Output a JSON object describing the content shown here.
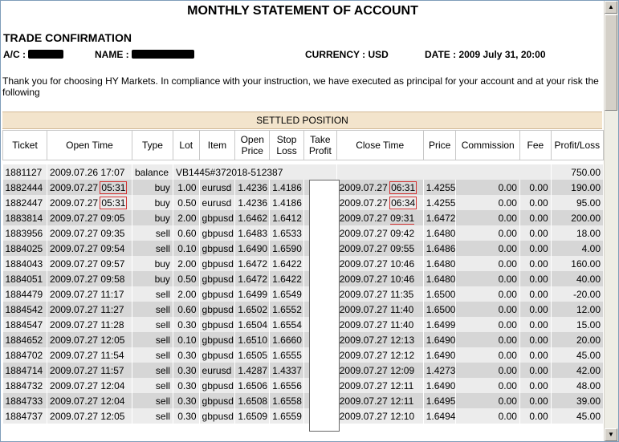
{
  "statement": {
    "title": "MONTHLY STATEMENT OF ACCOUNT",
    "section": "TRADE CONFIRMATION",
    "account_label": "A/C :",
    "name_label": "NAME :",
    "currency_label": "CURRENCY : USD",
    "date_label": "DATE : 2009 July 31, 20:00",
    "intro": "Thank you for choosing HY Markets. In compliance with your instruction, we have executed as principal for your account and at your risk the following",
    "settled_title": "SETTLED POSITION"
  },
  "table": {
    "headers": {
      "ticket": "Ticket",
      "open_time": "Open Time",
      "type": "Type",
      "lot": "Lot",
      "item": "Item",
      "open_price": "Open Price",
      "stop_loss": "Stop Loss",
      "take_profit": "Take Profit",
      "close_time": "Close Time",
      "price": "Price",
      "commission": "Commission",
      "fee": "Fee",
      "profit_loss": "Profit/Loss"
    },
    "balance_row": {
      "ticket": "1881127",
      "open_time": "2009.07.26 17:07",
      "type": "balance",
      "desc": "VB1445#372018-512387",
      "profit": "750.00"
    },
    "rows": [
      {
        "ticket": "1882444",
        "open_date": "2009.07.27",
        "open_hm": "05:31",
        "type": "buy",
        "lot": "1.00",
        "item": "eurusd",
        "open_price": "1.4236",
        "stop_loss": "1.4186",
        "close_date": "2009.07.27",
        "close_hm": "06:31",
        "price": "1.4255",
        "commission": "0.00",
        "fee": "0.00",
        "profit": "190.00"
      },
      {
        "ticket": "1882447",
        "open_date": "2009.07.27",
        "open_hm": "05:31",
        "type": "buy",
        "lot": "0.50",
        "item": "eurusd",
        "open_price": "1.4236",
        "stop_loss": "1.4186",
        "close_date": "2009.07.27",
        "close_hm": "06:34",
        "price": "1.4255",
        "commission": "0.00",
        "fee": "0.00",
        "profit": "95.00"
      },
      {
        "ticket": "1883814",
        "open_date": "2009.07.27",
        "open_hm": "09:05",
        "type": "buy",
        "lot": "2.00",
        "item": "gbpusd",
        "open_price": "1.6462",
        "stop_loss": "1.6412",
        "close_date": "2009.07.27",
        "close_hm": "09:31",
        "price": "1.6472",
        "commission": "0.00",
        "fee": "0.00",
        "profit": "200.00"
      },
      {
        "ticket": "1883956",
        "open_date": "2009.07.27",
        "open_hm": "09:35",
        "type": "sell",
        "lot": "0.60",
        "item": "gbpusd",
        "open_price": "1.6483",
        "stop_loss": "1.6533",
        "close_date": "2009.07.27",
        "close_hm": "09:42",
        "price": "1.6480",
        "commission": "0.00",
        "fee": "0.00",
        "profit": "18.00"
      },
      {
        "ticket": "1884025",
        "open_date": "2009.07.27",
        "open_hm": "09:54",
        "type": "sell",
        "lot": "0.10",
        "item": "gbpusd",
        "open_price": "1.6490",
        "stop_loss": "1.6590",
        "close_date": "2009.07.27",
        "close_hm": "09:55",
        "price": "1.6486",
        "commission": "0.00",
        "fee": "0.00",
        "profit": "4.00"
      },
      {
        "ticket": "1884043",
        "open_date": "2009.07.27",
        "open_hm": "09:57",
        "type": "buy",
        "lot": "2.00",
        "item": "gbpusd",
        "open_price": "1.6472",
        "stop_loss": "1.6422",
        "close_date": "2009.07.27",
        "close_hm": "10:46",
        "price": "1.6480",
        "commission": "0.00",
        "fee": "0.00",
        "profit": "160.00"
      },
      {
        "ticket": "1884051",
        "open_date": "2009.07.27",
        "open_hm": "09:58",
        "type": "buy",
        "lot": "0.50",
        "item": "gbpusd",
        "open_price": "1.6472",
        "stop_loss": "1.6422",
        "close_date": "2009.07.27",
        "close_hm": "10:46",
        "price": "1.6480",
        "commission": "0.00",
        "fee": "0.00",
        "profit": "40.00"
      },
      {
        "ticket": "1884479",
        "open_date": "2009.07.27",
        "open_hm": "11:17",
        "type": "sell",
        "lot": "2.00",
        "item": "gbpusd",
        "open_price": "1.6499",
        "stop_loss": "1.6549",
        "close_date": "2009.07.27",
        "close_hm": "11:35",
        "price": "1.6500",
        "commission": "0.00",
        "fee": "0.00",
        "profit": "-20.00"
      },
      {
        "ticket": "1884542",
        "open_date": "2009.07.27",
        "open_hm": "11:27",
        "type": "sell",
        "lot": "0.60",
        "item": "gbpusd",
        "open_price": "1.6502",
        "stop_loss": "1.6552",
        "close_date": "2009.07.27",
        "close_hm": "11:40",
        "price": "1.6500",
        "commission": "0.00",
        "fee": "0.00",
        "profit": "12.00"
      },
      {
        "ticket": "1884547",
        "open_date": "2009.07.27",
        "open_hm": "11:28",
        "type": "sell",
        "lot": "0.30",
        "item": "gbpusd",
        "open_price": "1.6504",
        "stop_loss": "1.6554",
        "close_date": "2009.07.27",
        "close_hm": "11:40",
        "price": "1.6499",
        "commission": "0.00",
        "fee": "0.00",
        "profit": "15.00"
      },
      {
        "ticket": "1884652",
        "open_date": "2009.07.27",
        "open_hm": "12:05",
        "type": "sell",
        "lot": "0.10",
        "item": "gbpusd",
        "open_price": "1.6510",
        "stop_loss": "1.6660",
        "close_date": "2009.07.27",
        "close_hm": "12:13",
        "price": "1.6490",
        "commission": "0.00",
        "fee": "0.00",
        "profit": "20.00"
      },
      {
        "ticket": "1884702",
        "open_date": "2009.07.27",
        "open_hm": "11:54",
        "type": "sell",
        "lot": "0.30",
        "item": "gbpusd",
        "open_price": "1.6505",
        "stop_loss": "1.6555",
        "close_date": "2009.07.27",
        "close_hm": "12:12",
        "price": "1.6490",
        "commission": "0.00",
        "fee": "0.00",
        "profit": "45.00"
      },
      {
        "ticket": "1884714",
        "open_date": "2009.07.27",
        "open_hm": "11:57",
        "type": "sell",
        "lot": "0.30",
        "item": "eurusd",
        "open_price": "1.4287",
        "stop_loss": "1.4337",
        "close_date": "2009.07.27",
        "close_hm": "12:09",
        "price": "1.4273",
        "commission": "0.00",
        "fee": "0.00",
        "profit": "42.00"
      },
      {
        "ticket": "1884732",
        "open_date": "2009.07.27",
        "open_hm": "12:04",
        "type": "sell",
        "lot": "0.30",
        "item": "gbpusd",
        "open_price": "1.6506",
        "stop_loss": "1.6556",
        "close_date": "2009.07.27",
        "close_hm": "12:11",
        "price": "1.6490",
        "commission": "0.00",
        "fee": "0.00",
        "profit": "48.00"
      },
      {
        "ticket": "1884733",
        "open_date": "2009.07.27",
        "open_hm": "12:04",
        "type": "sell",
        "lot": "0.30",
        "item": "gbpusd",
        "open_price": "1.6508",
        "stop_loss": "1.6558",
        "close_date": "2009.07.27",
        "close_hm": "12:11",
        "price": "1.6495",
        "commission": "0.00",
        "fee": "0.00",
        "profit": "39.00"
      },
      {
        "ticket": "1884737",
        "open_date": "2009.07.27",
        "open_hm": "12:05",
        "type": "sell",
        "lot": "0.30",
        "item": "gbpusd",
        "open_price": "1.6509",
        "stop_loss": "1.6559",
        "close_date": "2009.07.27",
        "close_hm": "12:10",
        "price": "1.6494",
        "commission": "0.00",
        "fee": "0.00",
        "profit": "45.00"
      }
    ]
  },
  "scrollbar": {
    "up_icon": "arrow-up-icon",
    "down_icon": "arrow-down-icon"
  },
  "colors": {
    "banner": "#f3e4cc",
    "row_dark": "#d6d6d6",
    "row_light": "#ececec",
    "highlight": "#d23030"
  }
}
